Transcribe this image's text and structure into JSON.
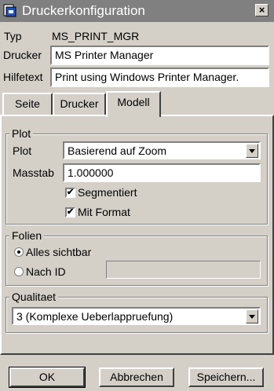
{
  "window": {
    "title": "Druckerkonfiguration",
    "close_glyph": "×"
  },
  "header": {
    "typ_label": "Typ",
    "typ_value": "MS_PRINT_MGR",
    "drucker_label": "Drucker",
    "drucker_value": "MS Printer Manager",
    "hilfetext_label": "Hilfetext",
    "hilfetext_value": "Print using Windows Printer Manager."
  },
  "tabs": [
    {
      "label": "Seite",
      "active": false
    },
    {
      "label": "Drucker",
      "active": false
    },
    {
      "label": "Modell",
      "active": true
    }
  ],
  "plot": {
    "group_label": "Plot",
    "plot_label": "Plot",
    "plot_value": "Basierend auf Zoom",
    "masstab_label": "Masstab",
    "masstab_value": "1.000000",
    "segmentiert_label": "Segmentiert",
    "segmentiert_checked": true,
    "mit_format_label": "Mit Format",
    "mit_format_checked": true
  },
  "folien": {
    "group_label": "Folien",
    "alles_label": "Alles sichtbar",
    "alles_selected": true,
    "nach_id_label": "Nach ID",
    "nach_id_selected": false,
    "nach_id_value": ""
  },
  "qualitaet": {
    "group_label": "Qualitaet",
    "value": "3 (Komplexe Ueberlappruefung)"
  },
  "buttons": {
    "ok": "OK",
    "abbrechen": "Abbrechen",
    "speichern": "Speichern..."
  },
  "check_glyph": "✔"
}
